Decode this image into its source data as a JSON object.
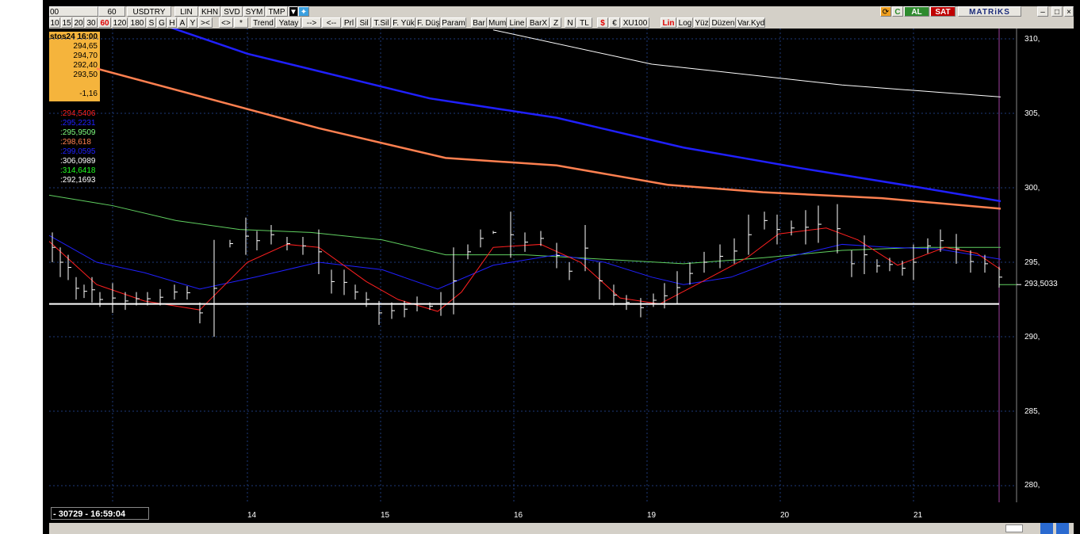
{
  "toolbar_top": {
    "items": [
      "00",
      "60",
      "USDTRY",
      "LIN",
      "KHN",
      "SVD",
      "SYM",
      "TMP",
      "▼"
    ],
    "al_label": "AL",
    "sat_label": "SAT",
    "brand": "MATRiKS"
  },
  "toolbar_bottom": {
    "items": [
      "10",
      "15",
      "20",
      "30",
      "60",
      "120",
      "180",
      "S",
      "G",
      "H",
      "A",
      "Y",
      "><",
      "<>",
      "*",
      "Trend",
      "Yatay",
      "-->",
      "<--",
      "Prl",
      "Sil",
      "T.Sil",
      "F. Yük",
      "F. Düş",
      "Param",
      "Bar",
      "Mum",
      "Line",
      "BarX",
      "Z",
      "N",
      "TL",
      "$",
      "€",
      "XU100",
      "Lin",
      "Log",
      "Yüz",
      "Düzen",
      "Var.Kyd"
    ]
  },
  "infobox": {
    "date": "stos24 16:00",
    "open": "294,65",
    "high": "294,70",
    "low": "292,40",
    "close": "293,50",
    "change": "-1,16"
  },
  "indicators": [
    {
      "value": ":294,5406",
      "color": "#ff2020"
    },
    {
      "value": ":295,2231",
      "color": "#2020ff"
    },
    {
      "value": ":295,9509",
      "color": "#80ff80"
    },
    {
      "value": ":298,618",
      "color": "#ff8050"
    },
    {
      "value": ":299,0595",
      "color": "#2020ff"
    },
    {
      "value": ":306,0989",
      "color": "#ffffff"
    },
    {
      "value": ":314,6418",
      "color": "#20ff20"
    },
    {
      "value": ":292,1693",
      "color": "#ffffff"
    }
  ],
  "yaxis": {
    "labels": [
      "310,",
      "305,",
      "300,",
      "295,",
      "290,",
      "285,",
      "280,"
    ],
    "current_price": "293,5033"
  },
  "xaxis": {
    "labels": [
      "14",
      "15",
      "16",
      "19",
      "20",
      "21"
    ]
  },
  "status": {
    "text": "- 30729 - 16:59:04"
  },
  "colors": {
    "ma_red": "#ff2020",
    "ma_blue": "#2020ff",
    "ma_green": "#80ff80",
    "ma_orange": "#ff8050",
    "ma_blue2": "#2020ff",
    "ma_white": "#ffffff"
  }
}
